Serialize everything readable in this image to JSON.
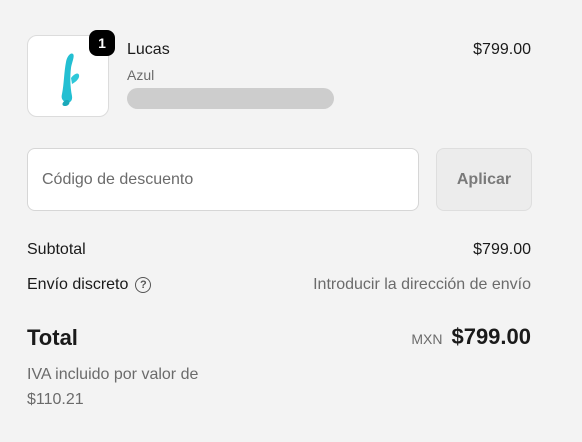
{
  "line_item": {
    "quantity": "1",
    "name": "Lucas",
    "variant": "Azul",
    "price": "$799.00",
    "image_icon": "product-thumbnail"
  },
  "discount": {
    "placeholder": "Código de descuento",
    "apply_label": "Aplicar"
  },
  "totals": {
    "subtotal_label": "Subtotal",
    "subtotal_value": "$799.00",
    "shipping_label": "Envío discreto",
    "shipping_help_icon": "question-circle-icon",
    "shipping_value": "Introducir la dirección de envío",
    "total_label": "Total",
    "currency": "MXN",
    "total_value": "$799.00",
    "tax_note": "IVA incluido por valor de $110.21"
  },
  "colors": {
    "background": "#f3f3f3",
    "product_color": "#2ec8d9",
    "badge": "#000000"
  }
}
